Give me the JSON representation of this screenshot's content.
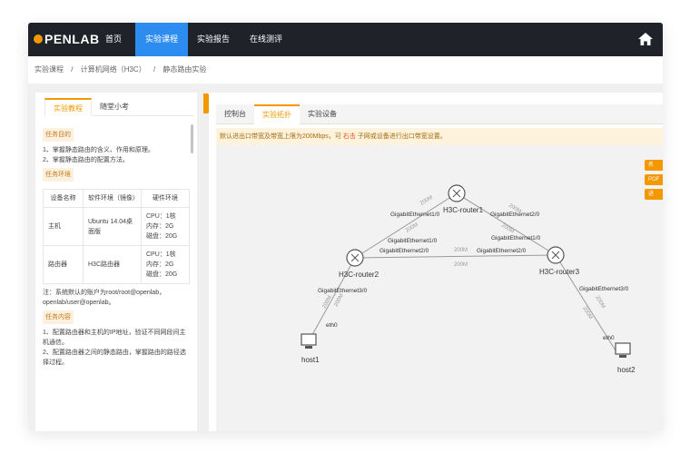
{
  "brand": {
    "logo_text": "PENLAB",
    "logo_prefix_color": "#f39800"
  },
  "nav": {
    "items": [
      {
        "label": "首页"
      },
      {
        "label": "实验课程"
      },
      {
        "label": "实验报告"
      },
      {
        "label": "在线测评"
      }
    ],
    "active_index": 1,
    "home_icon": "home-icon"
  },
  "breadcrumb": [
    "实验课程",
    "/",
    "计算机网络（H3C）",
    "/",
    "静态路由实验"
  ],
  "left_panel": {
    "tabs": [
      "实验教程",
      "随堂小考"
    ],
    "active_tab": 0,
    "sections": {
      "objective_title": "任务目的",
      "objective_lines": [
        "1、掌握静态路由的含义、作用和原理。",
        "2、掌握静态路由的配置方法。"
      ],
      "env_title": "任务环境",
      "table_headers": [
        "设备名称",
        "软件环境（镜像）",
        "硬件环境"
      ],
      "table_rows": [
        {
          "device": "主机",
          "software": "Ubuntu 14.04桌面版",
          "hw": [
            "CPU：1核",
            "内存：2G",
            "磁盘：20G"
          ]
        },
        {
          "device": "路由器",
          "software": "H3C路由器",
          "hw": [
            "CPU：1核",
            "内存：2G",
            "磁盘：20G"
          ]
        }
      ],
      "note": "注：系统默认的账户为root/root@openlab，openlab/user@openlab。",
      "content_title": "任务内容",
      "content_lines": [
        "1、配置路由器和主机的IP地址，验证不同网段间主机通信。",
        "2、配置路由器之间的静态路由，掌握路由的路径选择过程。"
      ]
    }
  },
  "right_panel": {
    "tabs": [
      "控制台",
      "实验拓扑",
      "实验设备"
    ],
    "active_tab": 1,
    "notice_prefix": "默认进出口带宽及带宽上限为200Mbps，可",
    "notice_highlight": "右击",
    "notice_suffix": "子网或设备进行出口带宽设置。",
    "side_buttons": [
      "名",
      "POF",
      "进"
    ],
    "topology": {
      "nodes": [
        {
          "id": "router1",
          "label": "H3C-router1"
        },
        {
          "id": "router2",
          "label": "H3C-router2"
        },
        {
          "id": "router3",
          "label": "H3C-router3"
        },
        {
          "id": "host1",
          "label": "host1"
        },
        {
          "id": "host2",
          "label": "host2"
        }
      ],
      "interface_labels": {
        "r1_left": "GigabitEthernet1/0",
        "r1_right": "GigabitEthernet2/0",
        "r2_top": "GigabitEthernet1/0",
        "r2_right": "GigabitEthernet2/0",
        "r2_bottom": "GigabitEthernet3/0",
        "r3_top": "GigabitEthernet1/0",
        "r3_left": "GigabitEthernet2/0",
        "r3_bottom": "GigabitEthernet3/0",
        "h1": "eth0",
        "h2": "eth0"
      },
      "bandwidth_labels": {
        "r1_r2_a": "200M",
        "r1_r2_b": "200M",
        "r1_r3_a": "200M",
        "r1_r3_b": "200M",
        "r2_r3_a": "200M",
        "r2_r3_b": "200M",
        "r2_h1_a": "200M",
        "r2_h1_b": "200M",
        "r3_h2_a": "200M",
        "r3_h2_b": "200M"
      }
    }
  }
}
